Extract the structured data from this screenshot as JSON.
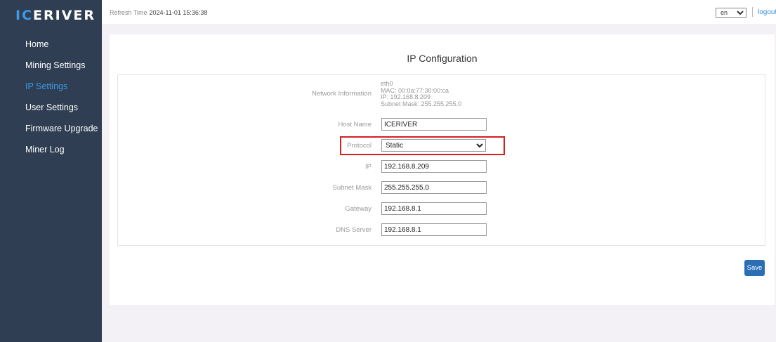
{
  "logo": {
    "part1": "IC",
    "part2": "ERIVER"
  },
  "sidebar": {
    "items": [
      {
        "label": "Home"
      },
      {
        "label": "Mining Settings"
      },
      {
        "label": "IP Settings"
      },
      {
        "label": "User Settings"
      },
      {
        "label": "Firmware Upgrade"
      },
      {
        "label": "Miner Log"
      }
    ],
    "active": "IP Settings"
  },
  "topbar": {
    "refresh_label": "Refresh Time",
    "refresh_time": "2024-11-01 15:36:38",
    "language": "en",
    "logout_label": "logout"
  },
  "page": {
    "title": "IP Configuration"
  },
  "network": {
    "label": "Network Information",
    "interface": "eth0",
    "mac": "MAC: 00:0a:77:30:00:ca",
    "ip": "IP: 192.168.8.209",
    "subnet": "Subnet Mask: 255.255.255.0"
  },
  "form": {
    "host_name_label": "Host Name",
    "host_name": "ICERIVER",
    "protocol_label": "Protocol",
    "protocol": "Static",
    "ip_label": "IP",
    "ip": "192.168.8.209",
    "subnet_label": "Subnet Mask",
    "subnet": "255.255.255.0",
    "gateway_label": "Gateway",
    "gateway": "192.168.8.1",
    "dns_label": "DNS Server",
    "dns": "192.168.8.1",
    "save_label": "Save"
  },
  "colors": {
    "sidebar_bg": "#2f3e52",
    "accent": "#3b9be8",
    "highlight": "#d42020",
    "button": "#2a6fb6"
  }
}
